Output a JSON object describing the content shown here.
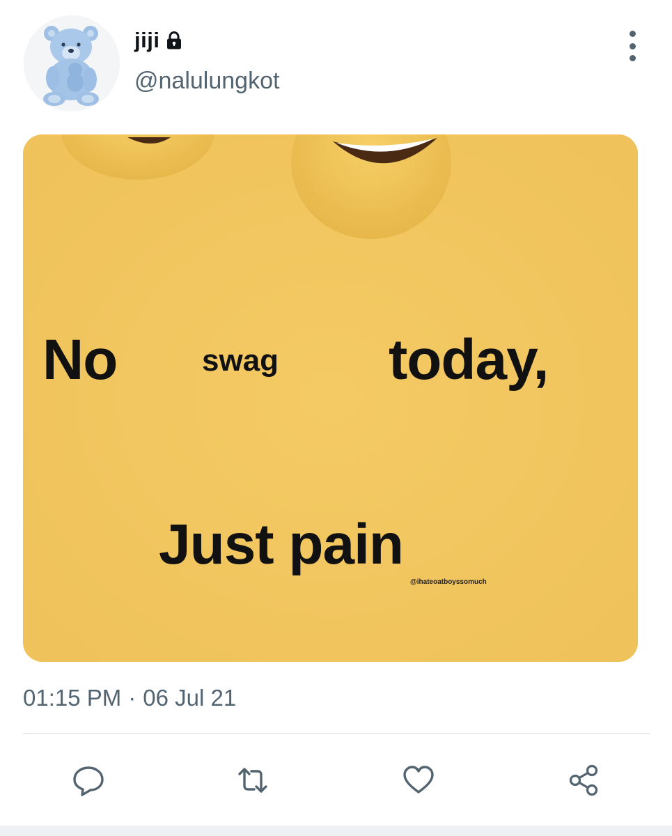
{
  "tweet": {
    "author": {
      "display_name": "jiji",
      "handle": "@nalulungkot",
      "protected_icon": "lock-icon",
      "avatar_icon": "teddy-bear-avatar"
    },
    "more_icon": "more-vertical-icon",
    "media": {
      "background_color": "#f2c65e",
      "text_line1_word1": "No",
      "text_line1_word2": "swag",
      "text_line1_word3": "today,",
      "text_line2": "Just pain",
      "watermark": "@ihateoatboyssomuch"
    },
    "timestamp": {
      "time": "01:15 PM",
      "separator": "·",
      "date": "06 Jul 21"
    },
    "actions": [
      {
        "name": "reply",
        "icon": "reply-icon"
      },
      {
        "name": "retweet",
        "icon": "retweet-icon"
      },
      {
        "name": "like",
        "icon": "heart-icon"
      },
      {
        "name": "share",
        "icon": "share-icon"
      }
    ],
    "colors": {
      "secondary_text": "#536471",
      "primary_text": "#0f1419",
      "divider": "#e6ecf0"
    }
  }
}
